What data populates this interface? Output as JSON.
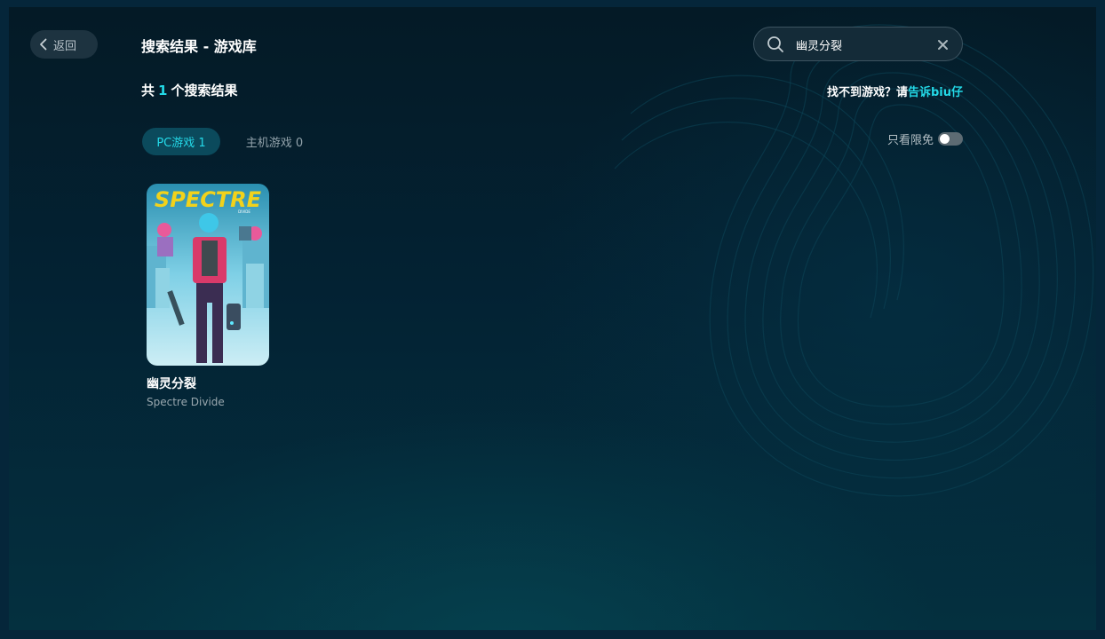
{
  "header": {
    "back_label": "返回",
    "title": "搜索结果 - 游戏库"
  },
  "search": {
    "value": "幽灵分裂",
    "placeholder": ""
  },
  "results": {
    "prefix": "共",
    "count": "1",
    "suffix": "个搜索结果"
  },
  "help": {
    "text": "找不到游戏？请",
    "link": "告诉biu仔"
  },
  "tabs": [
    {
      "label": "PC游戏 1",
      "active": true
    },
    {
      "label": "主机游戏 0",
      "active": false
    }
  ],
  "filter": {
    "free_only_label": "只看限免",
    "free_only_on": false
  },
  "games": [
    {
      "title": "幽灵分裂",
      "subtitle": "Spectre Divide",
      "cover_logo": "SPECTRE",
      "cover_logo_sub": "DIVIDE"
    }
  ],
  "colors": {
    "accent": "#23d8e6",
    "background": "#04202e",
    "logo_yellow": "#f2d21b"
  },
  "icons": {
    "back": "chevron-left-icon",
    "search": "search-icon",
    "clear": "close-icon"
  }
}
